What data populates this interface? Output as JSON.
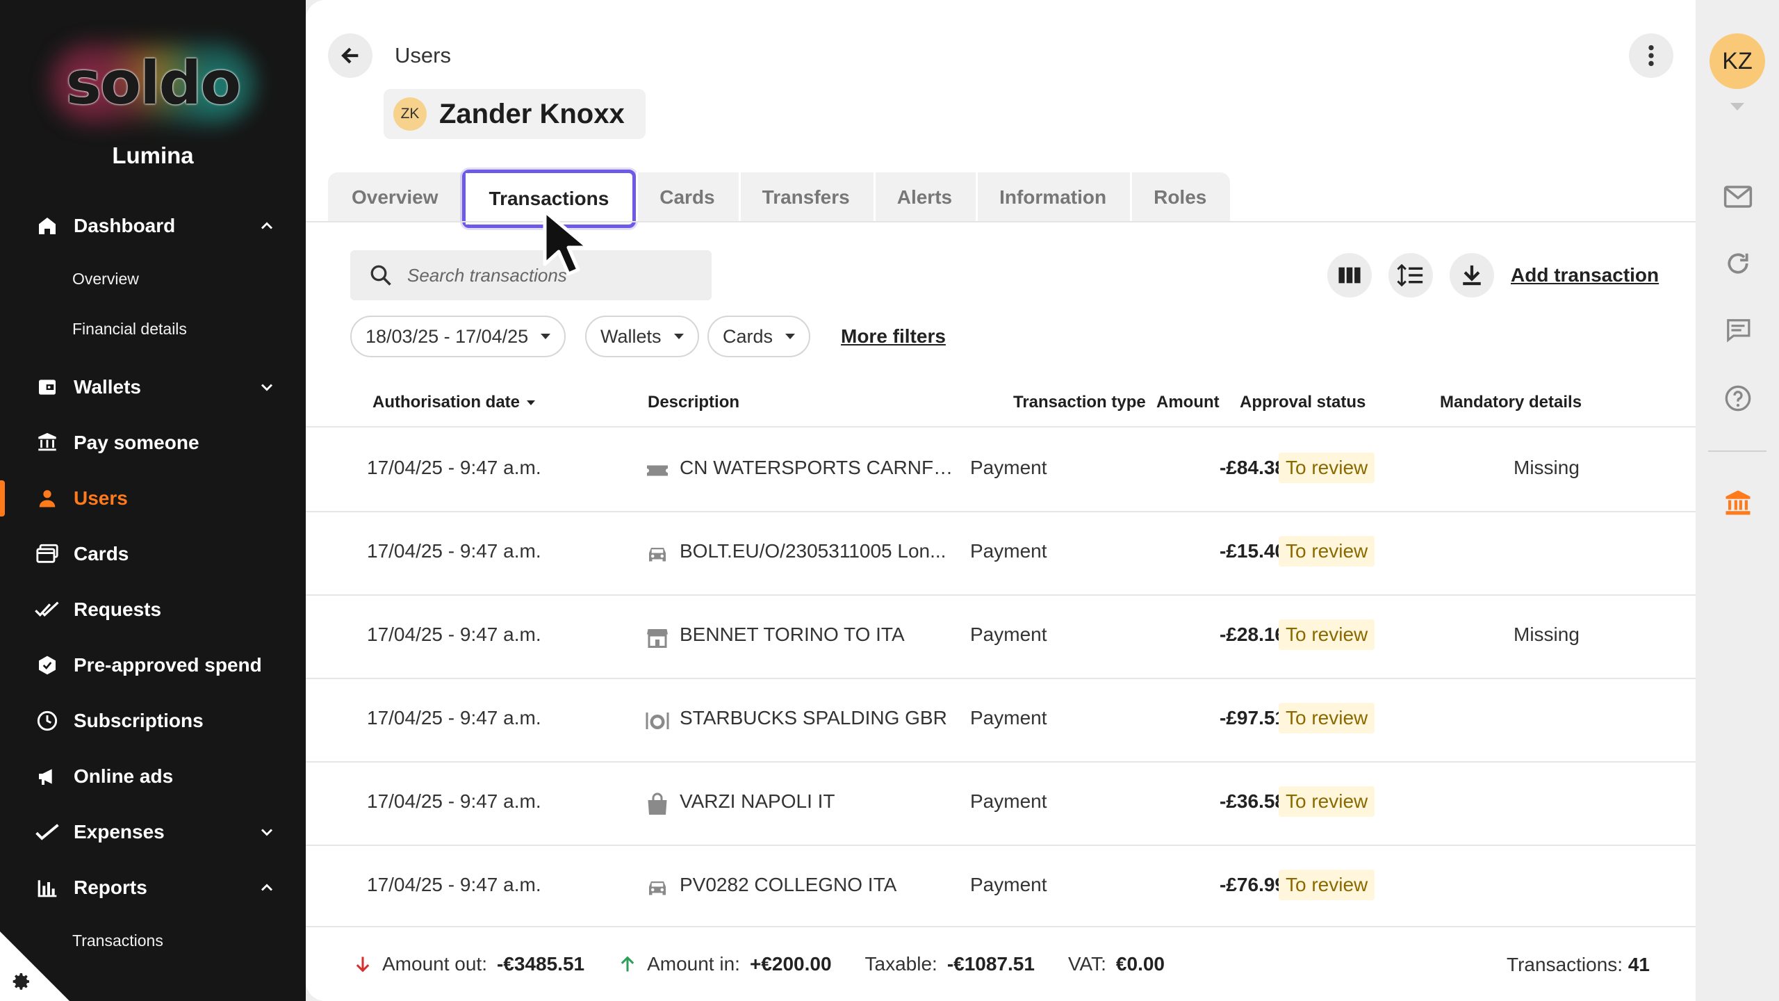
{
  "sidebar": {
    "logo_text": "soldo",
    "org_name": "Lumina",
    "items": [
      {
        "label": "Dashboard"
      },
      {
        "label": "Overview"
      },
      {
        "label": "Financial details"
      },
      {
        "label": "Wallets"
      },
      {
        "label": "Pay someone"
      },
      {
        "label": "Users"
      },
      {
        "label": "Cards"
      },
      {
        "label": "Requests"
      },
      {
        "label": "Pre-approved spend"
      },
      {
        "label": "Subscriptions"
      },
      {
        "label": "Online ads"
      },
      {
        "label": "Expenses"
      },
      {
        "label": "Reports"
      },
      {
        "label": "Transactions"
      }
    ],
    "active_item": "Users",
    "accent_color": "#ff7a1a"
  },
  "header": {
    "breadcrumb": "Users",
    "user_initials": "ZK",
    "user_name": "Zander Knoxx"
  },
  "tabs": [
    "Overview",
    "Transactions",
    "Cards",
    "Transfers",
    "Alerts",
    "Information",
    "Roles"
  ],
  "active_tab": "Transactions",
  "toolbar": {
    "search_placeholder": "Search transactions",
    "add_transaction_label": "Add transaction",
    "icons": [
      "columns-icon",
      "row-density-icon",
      "download-icon"
    ]
  },
  "filters": {
    "date_range": "18/03/25 - 17/04/25",
    "wallets": "Wallets",
    "cards": "Cards",
    "more_filters": "More filters"
  },
  "table": {
    "columns": [
      "Authorisation date",
      "Description",
      "Transaction type",
      "Amount",
      "Approval status",
      "Mandatory details"
    ],
    "rows": [
      {
        "date": "17/04/25 - 9:47 a.m.",
        "icon": "ticket-icon",
        "description": "CN WATERSPORTS CARNFOR...",
        "type": "Payment",
        "amount": "-£84.38",
        "status": "To review",
        "mandatory": "Missing"
      },
      {
        "date": "17/04/25 - 9:47 a.m.",
        "icon": "car-icon",
        "description": "BOLT.EU/O/2305311005 Lon...",
        "type": "Payment",
        "amount": "-£15.40",
        "status": "To review",
        "mandatory": ""
      },
      {
        "date": "17/04/25 - 9:47 a.m.",
        "icon": "store-icon",
        "description": "BENNET TORINO TO ITA",
        "type": "Payment",
        "amount": "-£28.16",
        "status": "To review",
        "mandatory": "Missing"
      },
      {
        "date": "17/04/25 - 9:47 a.m.",
        "icon": "restaurant-icon",
        "description": "STARBUCKS SPALDING GBR",
        "type": "Payment",
        "amount": "-£97.51",
        "status": "To review",
        "mandatory": ""
      },
      {
        "date": "17/04/25 - 9:47 a.m.",
        "icon": "shopping-bag-icon",
        "description": "VARZI NAPOLI IT",
        "type": "Payment",
        "amount": "-£36.58",
        "status": "To review",
        "mandatory": ""
      },
      {
        "date": "17/04/25 - 9:47 a.m.",
        "icon": "car-icon",
        "description": "PV0282 COLLEGNO ITA",
        "type": "Payment",
        "amount": "-£76.99",
        "status": "To review",
        "mandatory": ""
      }
    ]
  },
  "footer": {
    "amount_out_label": "Amount out:",
    "amount_out_value": "-€3485.51",
    "amount_in_label": "Amount in:",
    "amount_in_value": "+€200.00",
    "taxable_label": "Taxable:",
    "taxable_value": "-€1087.51",
    "vat_label": "VAT:",
    "vat_value": "€0.00",
    "transactions_label": "Transactions:",
    "transactions_value": "41"
  },
  "rail": {
    "user_initials": "KZ",
    "icons": [
      "mail-icon",
      "refresh-icon",
      "chat-icon",
      "help-icon",
      "bank-icon"
    ]
  }
}
